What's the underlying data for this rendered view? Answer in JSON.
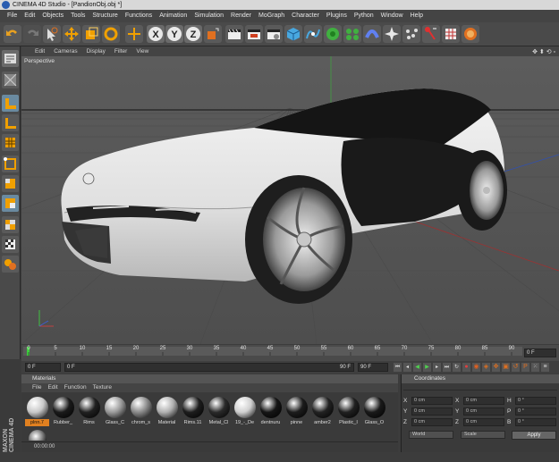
{
  "window": {
    "title": "CINEMA 4D Studio - [PandionObj.obj *]"
  },
  "menu": [
    "File",
    "Edit",
    "Objects",
    "Tools",
    "Structure",
    "Functions",
    "Animation",
    "Simulation",
    "Render",
    "MoGraph",
    "Character",
    "Plugins",
    "Python",
    "Window",
    "Help"
  ],
  "viewport": {
    "menu": [
      "Edit",
      "Cameras",
      "Display",
      "Filter",
      "View"
    ],
    "label": "Perspective"
  },
  "timeline": {
    "ticks": [
      "0",
      "5",
      "10",
      "15",
      "20",
      "25",
      "30",
      "35",
      "40",
      "45",
      "50",
      "55",
      "60",
      "65",
      "70",
      "75",
      "80",
      "85",
      "90"
    ],
    "end_field": "0 F"
  },
  "timebar": {
    "current": "0 F",
    "start": "0 F",
    "end": "90 F",
    "end2": "90 F"
  },
  "materials": {
    "title": "Materials",
    "menu": [
      "File",
      "Edit",
      "Function",
      "Texture"
    ],
    "items": [
      {
        "label": "plnn.7",
        "color": "#c8c8c8"
      },
      {
        "label": "Rubber_",
        "color": "#1a1a1a"
      },
      {
        "label": "Rims",
        "color": "#202020"
      },
      {
        "label": "Glass_C",
        "color": "#9a9a9a"
      },
      {
        "label": "chrom_s",
        "color": "#8a8a8a"
      },
      {
        "label": "Material",
        "color": "#b0b0b0"
      },
      {
        "label": "Rims.11",
        "color": "#1d1d1d"
      },
      {
        "label": "Metal_Cl",
        "color": "#2a2a2a"
      },
      {
        "label": "19_-_De",
        "color": "#d0d0d0"
      },
      {
        "label": "dentnuru",
        "color": "#151515"
      },
      {
        "label": "pinne",
        "color": "#1c1c1c"
      },
      {
        "label": "amber2",
        "color": "#222222"
      },
      {
        "label": "Plastic_I",
        "color": "#202020"
      },
      {
        "label": "Glass_O",
        "color": "#191919"
      }
    ]
  },
  "coordinates": {
    "title": "Coordinates",
    "rows": [
      {
        "a1": "X",
        "v1": "0 cm",
        "a2": "X",
        "v2": "0 cm",
        "a3": "H",
        "v3": "0 °"
      },
      {
        "a1": "Y",
        "v1": "0 cm",
        "a2": "Y",
        "v2": "0 cm",
        "a3": "P",
        "v3": "0 °"
      },
      {
        "a1": "Z",
        "v1": "0 cm",
        "a2": "Z",
        "v2": "0 cm",
        "a3": "B",
        "v3": "0 °"
      }
    ],
    "mode1": "World",
    "mode2": "Scale",
    "apply": "Apply"
  },
  "status": {
    "time": "00:00:00"
  },
  "brand": "MAXON CINEMA 4D"
}
